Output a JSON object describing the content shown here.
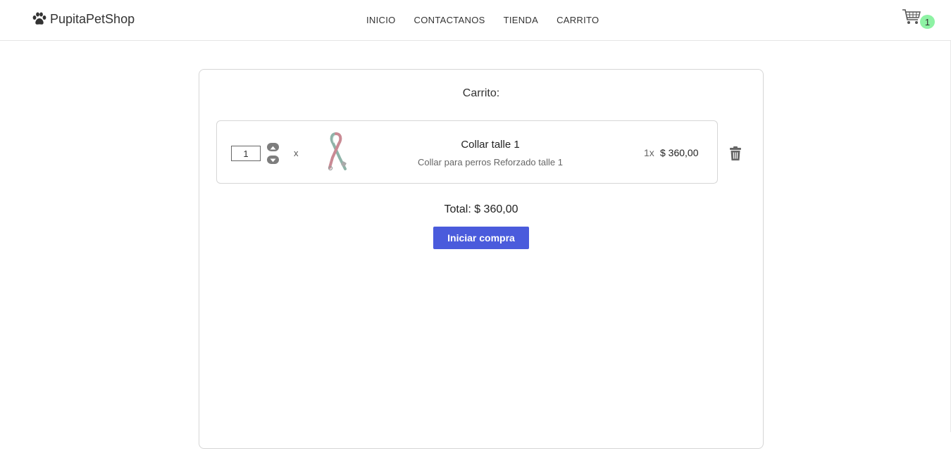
{
  "navbar": {
    "brand": "PupitaPetShop",
    "links": [
      "INICIO",
      "CONTACTANOS",
      "TIENDA",
      "CARRITO"
    ],
    "cart_count": "1"
  },
  "cart": {
    "title": "Carrito:",
    "items": [
      {
        "quantity": "1",
        "times": "x",
        "name": "Collar talle 1",
        "description": "Collar para perros Reforzado talle 1",
        "qty_label": "1x",
        "price": "$ 360,00"
      }
    ],
    "total": "Total: $ 360,00",
    "checkout_label": "Iniciar compra"
  },
  "colors": {
    "accent": "#4a5bdc",
    "badge": "#8ef2a4"
  }
}
